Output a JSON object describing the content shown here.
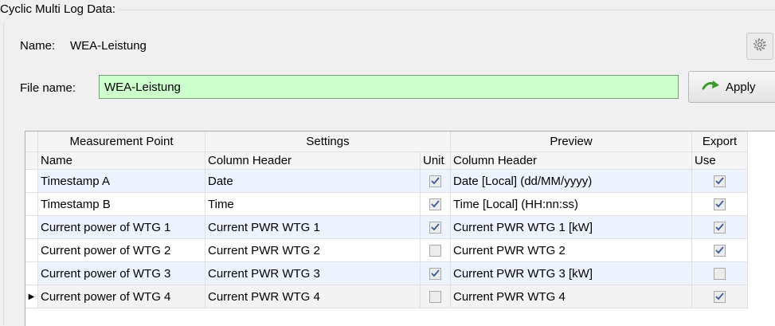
{
  "group": {
    "title": "Cyclic Multi Log Data:"
  },
  "name_row": {
    "label": "Name:",
    "value": "WEA-Leistung"
  },
  "settings_icon": "gear-icon",
  "file_row": {
    "label": "File name:",
    "value": "WEA-Leistung",
    "input_bg": "#ccffcc"
  },
  "apply_button": {
    "label": "Apply",
    "icon": "green-arrow-icon"
  },
  "table": {
    "group_headers": [
      "Measurement Point",
      "Settings",
      "Preview",
      "Export"
    ],
    "column_headers": [
      "Name",
      "Column Header",
      "Unit",
      "Column Header",
      "Use"
    ],
    "rows": [
      {
        "name": "Timestamp A",
        "header": "Date",
        "unit": true,
        "preview": "Date [Local] (dd/MM/yyyy)",
        "use": true
      },
      {
        "name": "Timestamp B",
        "header": "Time",
        "unit": true,
        "preview": "Time [Local] (HH:nn:ss)",
        "use": true
      },
      {
        "name": "Current power of WTG 1",
        "header": "Current PWR WTG 1",
        "unit": true,
        "preview": "Current PWR WTG 1 [kW]",
        "use": true
      },
      {
        "name": "Current power of WTG 2",
        "header": "Current PWR WTG 2",
        "unit": false,
        "preview": "Current PWR WTG 2",
        "use": true
      },
      {
        "name": "Current power of WTG 3",
        "header": "Current PWR WTG 3",
        "unit": true,
        "preview": "Current PWR WTG 3 [kW]",
        "use": false
      },
      {
        "name": "Current power of WTG 4",
        "header": "Current PWR WTG 4",
        "unit": false,
        "preview": "Current PWR WTG 4",
        "use": true
      }
    ]
  }
}
